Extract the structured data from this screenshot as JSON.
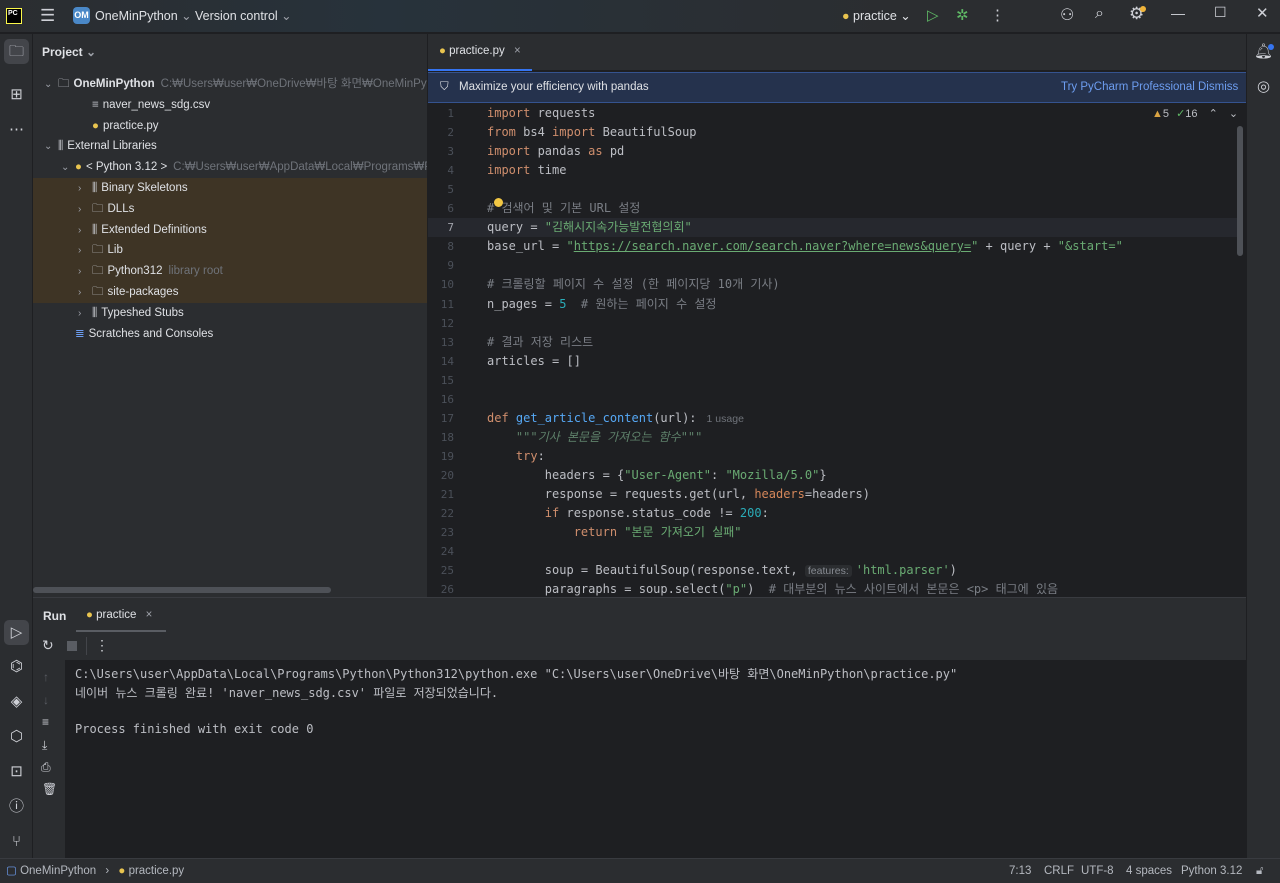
{
  "titlebar": {
    "logo": "PC",
    "project_badge": "OM",
    "project": "OneMinPython",
    "vcs": "Version control",
    "run_config": "practice"
  },
  "project_panel": {
    "title": "Project",
    "items": [
      {
        "label": "OneMinPython",
        "sub": "C:₩Users₩user₩OneDrive₩바탕 화면₩OneMinPython",
        "icon": "folder-icon",
        "depth": 0,
        "chev": "⌄",
        "bold": true
      },
      {
        "label": "naver_news_sdg.csv",
        "sub": "",
        "icon": "text-file-icon",
        "depth": 2,
        "chev": ""
      },
      {
        "label": "practice.py",
        "sub": "",
        "icon": "python-file-icon",
        "depth": 2,
        "chev": ""
      },
      {
        "label": "External Libraries",
        "sub": "",
        "icon": "library-icon",
        "depth": 0,
        "chev": "⌄"
      },
      {
        "label": "< Python 3.12 >",
        "sub": "C:₩Users₩user₩AppData₩Local₩Programs₩Python₩",
        "icon": "python-icon",
        "depth": 1,
        "chev": "⌄"
      },
      {
        "label": "Binary Skeletons",
        "sub": "",
        "icon": "library-icon",
        "depth": 2,
        "chev": "›",
        "hl": true
      },
      {
        "label": "DLLs",
        "sub": "",
        "icon": "folder-icon",
        "depth": 2,
        "chev": "›",
        "hl": true
      },
      {
        "label": "Extended Definitions",
        "sub": "",
        "icon": "library-icon",
        "depth": 2,
        "chev": "›",
        "hl": true
      },
      {
        "label": "Lib",
        "sub": "",
        "icon": "folder-icon",
        "depth": 2,
        "chev": "›",
        "hl": true
      },
      {
        "label": "Python312",
        "sub": "library root",
        "icon": "folder-icon",
        "depth": 2,
        "chev": "›",
        "hl": true
      },
      {
        "label": "site-packages",
        "sub": "",
        "icon": "folder-icon",
        "depth": 2,
        "chev": "›",
        "hl": true
      },
      {
        "label": "Typeshed Stubs",
        "sub": "",
        "icon": "library-icon",
        "depth": 2,
        "chev": "›"
      },
      {
        "label": "Scratches and Consoles",
        "sub": "",
        "icon": "scratches-icon",
        "depth": 1,
        "chev": ""
      }
    ]
  },
  "editor": {
    "tab": "practice.py",
    "banner": {
      "text": "Maximize your efficiency with pandas",
      "action": "Try PyCharm Professional",
      "dismiss": "Dismiss"
    },
    "warnings": "5",
    "weak_warnings": "16",
    "current_line": 7,
    "lines": [
      [
        [
          "kw",
          "import"
        ],
        [
          "plain",
          " requests"
        ]
      ],
      [
        [
          "kw",
          "from"
        ],
        [
          "plain",
          " bs4 "
        ],
        [
          "kw",
          "import"
        ],
        [
          "plain",
          " BeautifulSoup"
        ]
      ],
      [
        [
          "kw",
          "import"
        ],
        [
          "plain",
          " pandas "
        ],
        [
          "kw",
          "as"
        ],
        [
          "plain",
          " pd"
        ]
      ],
      [
        [
          "kw",
          "import"
        ],
        [
          "plain",
          " time"
        ]
      ],
      [],
      [
        [
          "comment",
          "# 검색어 및 기본 URL 설정"
        ]
      ],
      [
        [
          "plain",
          "query = "
        ],
        [
          "str",
          "\"김해시지속가능발전협의회\""
        ]
      ],
      [
        [
          "plain",
          "base_url = "
        ],
        [
          "str",
          "\""
        ],
        [
          "link",
          "https://search.naver.com/search.naver?where=news&query="
        ],
        [
          "str",
          "\""
        ],
        [
          "plain",
          " + query + "
        ],
        [
          "str",
          "\"&start=\""
        ]
      ],
      [],
      [
        [
          "comment",
          "# 크롤링할 페이지 수 설정 (한 페이지당 10개 기사)"
        ]
      ],
      [
        [
          "plain",
          "n_pages = "
        ],
        [
          "num",
          "5"
        ],
        [
          "comment",
          "  # 원하는 페이지 수 설정"
        ]
      ],
      [],
      [
        [
          "comment",
          "# 결과 저장 리스트"
        ]
      ],
      [
        [
          "plain",
          "articles = []"
        ]
      ],
      [],
      [],
      [
        [
          "kw",
          "def "
        ],
        [
          "fn",
          "get_article_content"
        ],
        [
          "plain",
          "(url):"
        ],
        [
          "usage",
          "1 usage"
        ]
      ],
      [
        [
          "plain",
          "    "
        ],
        [
          "doc",
          "\"\"\"기사 본문을 가져오는 함수\"\"\""
        ]
      ],
      [
        [
          "plain",
          "    "
        ],
        [
          "kw",
          "try"
        ],
        [
          "plain",
          ":"
        ]
      ],
      [
        [
          "plain",
          "        headers = {"
        ],
        [
          "str",
          "\"User-Agent\""
        ],
        [
          "plain",
          ": "
        ],
        [
          "str",
          "\"Mozilla/5.0\""
        ],
        [
          "plain",
          "}"
        ]
      ],
      [
        [
          "plain",
          "        response = requests.get(url, "
        ],
        [
          "param",
          "headers"
        ],
        [
          "plain",
          "=headers)"
        ]
      ],
      [
        [
          "plain",
          "        "
        ],
        [
          "kw",
          "if"
        ],
        [
          "plain",
          " response.status_code != "
        ],
        [
          "num",
          "200"
        ],
        [
          "plain",
          ":"
        ]
      ],
      [
        [
          "plain",
          "            "
        ],
        [
          "kw",
          "return "
        ],
        [
          "str",
          "\"본문 가져오기 실패\""
        ]
      ],
      [],
      [
        [
          "plain",
          "        soup = BeautifulSoup(response.text, "
        ],
        [
          "hint",
          "features:"
        ],
        [
          "str",
          "'html.parser'"
        ],
        [
          "plain",
          ")"
        ]
      ],
      [
        [
          "plain",
          "        paragraphs = soup.select("
        ],
        [
          "str",
          "\"p\""
        ],
        [
          "plain",
          ")  "
        ],
        [
          "comment",
          "# 대부분의 뉴스 사이트에서 본문은 <p> 태그에 있음"
        ]
      ]
    ]
  },
  "run": {
    "title": "Run",
    "tab": "practice",
    "output": [
      "C:\\Users\\user\\AppData\\Local\\Programs\\Python\\Python312\\python.exe \"C:\\Users\\user\\OneDrive\\바탕 화면\\OneMinPython\\practice.py\"",
      "네이버 뉴스 크롤링 완료! 'naver_news_sdg.csv' 파일로 저장되었습니다.",
      "",
      "Process finished with exit code 0"
    ]
  },
  "status": {
    "breadcrumb_project": "OneMinPython",
    "breadcrumb_file": "practice.py",
    "position": "7:13",
    "line_sep": "CRLF",
    "encoding": "UTF-8",
    "indent": "4 spaces",
    "interpreter": "Python 3.12"
  },
  "colors": {
    "accent": "#3574f0",
    "run_green": "#5fb865",
    "banner_bg": "#25324d",
    "highlight_row": "#3e3425"
  }
}
